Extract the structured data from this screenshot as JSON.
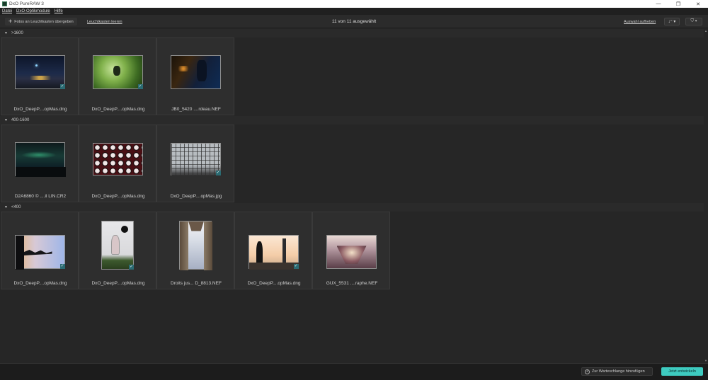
{
  "window": {
    "title": "DxO PureRAW 3",
    "minimize_glyph": "—",
    "restore_glyph": "❐",
    "close_glyph": "✕"
  },
  "menu": {
    "items": [
      "Datei",
      "DxO-Optikmodule",
      "Hilfe"
    ]
  },
  "toolbar": {
    "add_label": "Fotos an Leuchtkasten übergeben",
    "clear_label": "Leuchtkasten leeren",
    "selection_count": "11 von 11 ausgewählt",
    "deselect_label": "Auswahl aufheben",
    "sort_glyph": "↓⁼ ▾",
    "filter_glyph": "⛉ ▾"
  },
  "groups": [
    {
      "label": ">1600",
      "items": [
        {
          "filename": "DxO_DeepP....opMas.dng",
          "checked": true,
          "icon": "night-city-thumbnail"
        },
        {
          "filename": "DxO_DeepP....opMas.dng",
          "checked": true,
          "icon": "green-foliage-thumbnail"
        },
        {
          "filename": "JB0_5420 ....rdeau.NEF",
          "checked": false,
          "icon": "dark-blue-night-thumbnail"
        }
      ]
    },
    {
      "label": "400-1600",
      "items": [
        {
          "filename": "D2A6860 © ....il LIN.CR2",
          "checked": false,
          "icon": "aurora-thumbnail"
        },
        {
          "filename": "DxO_DeepP....opMas.dng",
          "checked": false,
          "icon": "polka-dot-thumbnail"
        },
        {
          "filename": "DxO_DeepP....opMas.jpg",
          "checked": true,
          "icon": "glass-roof-thumbnail"
        }
      ]
    },
    {
      "label": "<400",
      "items": [
        {
          "filename": "DxO_DeepP....opMas.dng",
          "checked": true,
          "icon": "silhouette-tree-thumbnail"
        },
        {
          "filename": "DxO_DeepP....opMas.dng",
          "checked": true,
          "icon": "dancer-thumbnail"
        },
        {
          "filename": "Droits jus... D_8813.NEF",
          "checked": false,
          "icon": "architecture-thumbnail"
        },
        {
          "filename": "DxO_DeepP....opMas.dng",
          "checked": true,
          "icon": "skyline-silhouette-thumbnail"
        },
        {
          "filename": "GUX_5531 ....raphe.NEF",
          "checked": false,
          "icon": "corridor-thumbnail"
        }
      ]
    }
  ],
  "footer": {
    "queue_label": "Zur Warteschlange hinzufügen",
    "develop_label": "Jetzt entwickeln"
  },
  "colors": {
    "accent": "#3ecbc0",
    "check": "#2b6b73"
  }
}
